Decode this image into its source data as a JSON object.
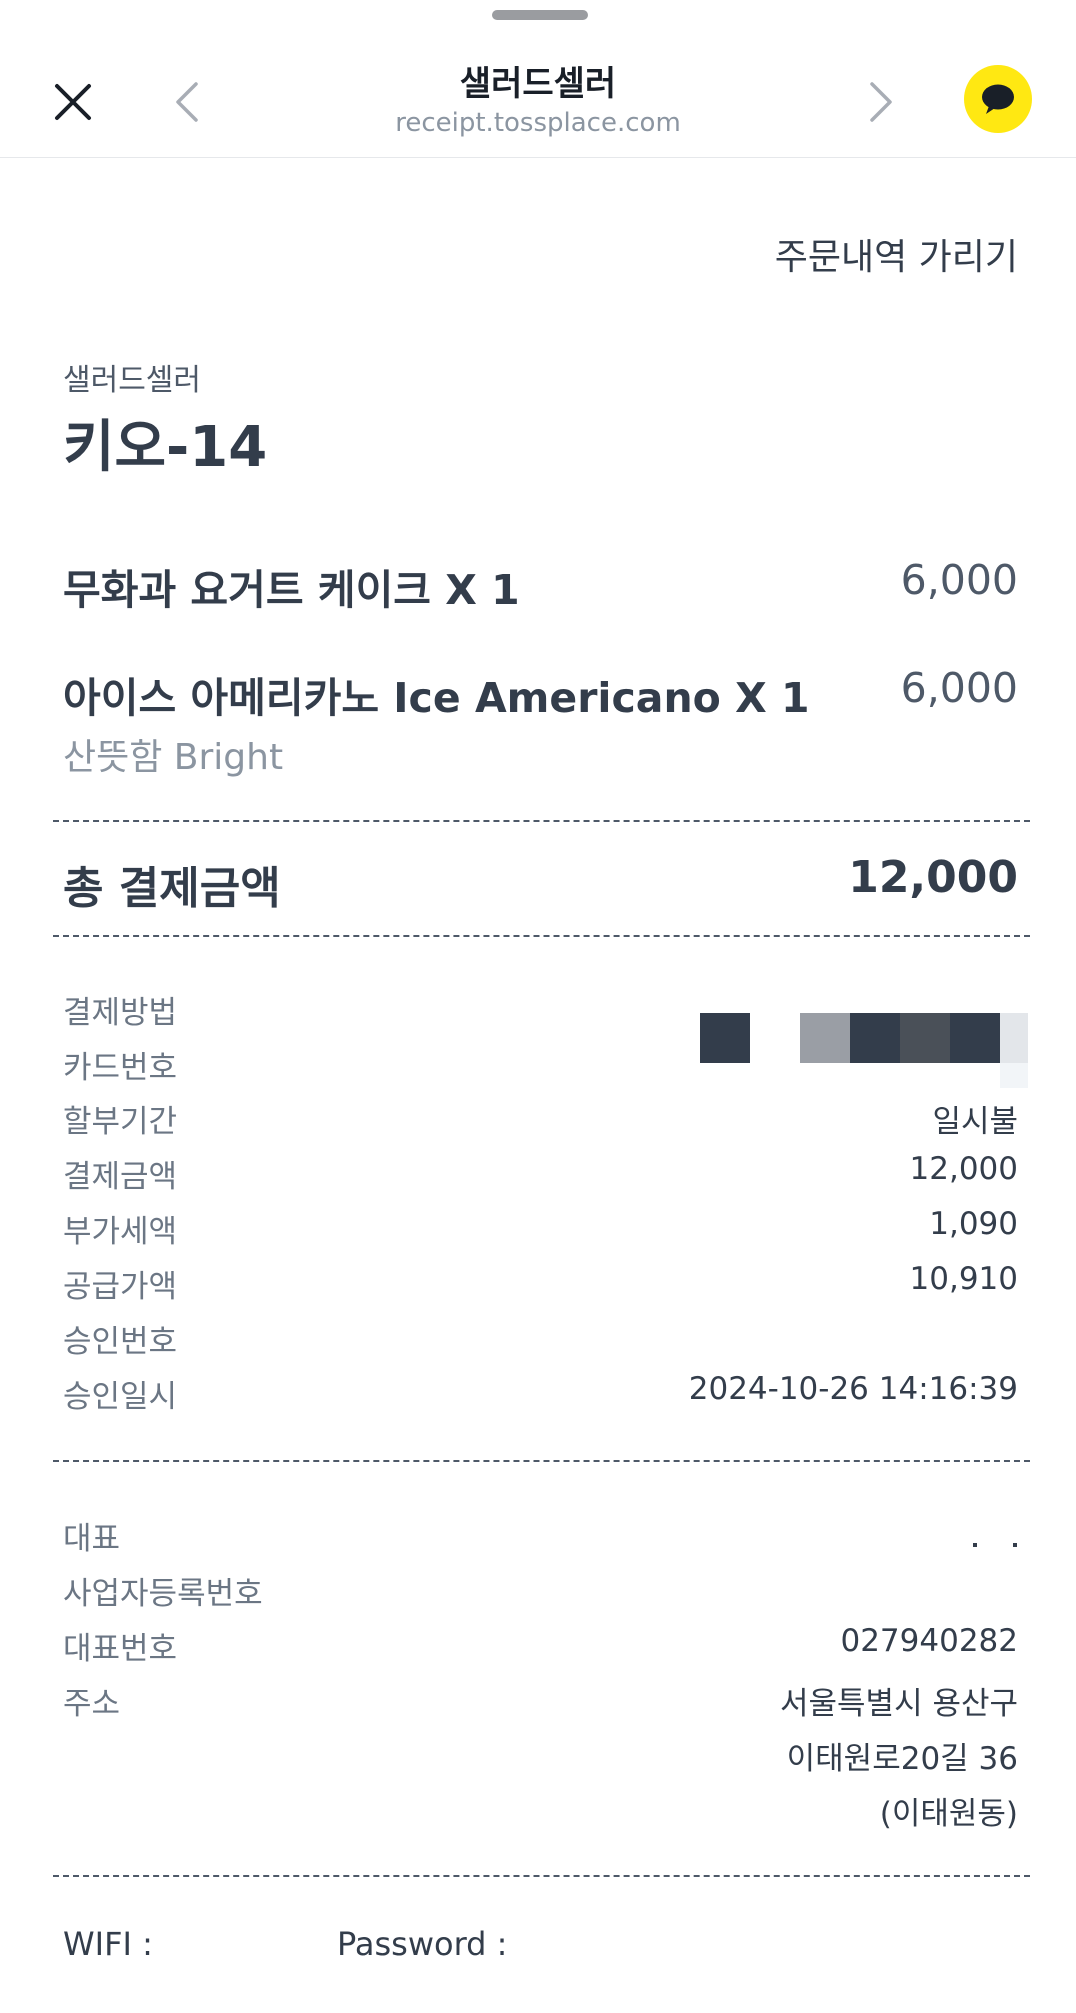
{
  "header": {
    "title": "샐러드셀러",
    "url": "receipt.tossplace.com",
    "close_icon": "close-icon",
    "back_icon": "chevron-left-icon",
    "forward_icon": "chevron-right-icon",
    "chat_icon": "kakaotalk-chat-icon",
    "chat_color": "#FFE812"
  },
  "receipt": {
    "toggle_label": "주문내역 가리기",
    "store_name": "샐러드셀러",
    "order_number": "키오-14",
    "items": [
      {
        "name": "무화과 요거트 케이크 X 1",
        "price": "6,000"
      },
      {
        "name": "아이스 아메리카노 Ice Americano X 1",
        "price": "6,000",
        "option": "산뜻함 Bright"
      }
    ],
    "total_label": "총 결제금액",
    "total_value": "12,000",
    "payment": {
      "method_label": "결제방법",
      "card_label": "카드번호",
      "installment_label": "할부기간",
      "installment_value": "일시불",
      "amount_label": "결제금액",
      "amount_value": "12,000",
      "vat_label": "부가세액",
      "vat_value": "1,090",
      "supply_label": "공급가액",
      "supply_value": "10,910",
      "approval_no_label": "승인번호",
      "approval_time_label": "승인일시",
      "approval_time_value": "2024-10-26 14:16:39"
    },
    "business": {
      "ceo_label": "대표",
      "reg_label": "사업자등록번호",
      "phone_label": "대표번호",
      "phone_value": "027940282",
      "address_label": "주소",
      "address_line1": "서울특별시 용산구",
      "address_line2": "이태원로20길 36",
      "address_line3": "(이태원동)"
    },
    "wifi_label": "WIFI :",
    "password_label": "Password :"
  }
}
